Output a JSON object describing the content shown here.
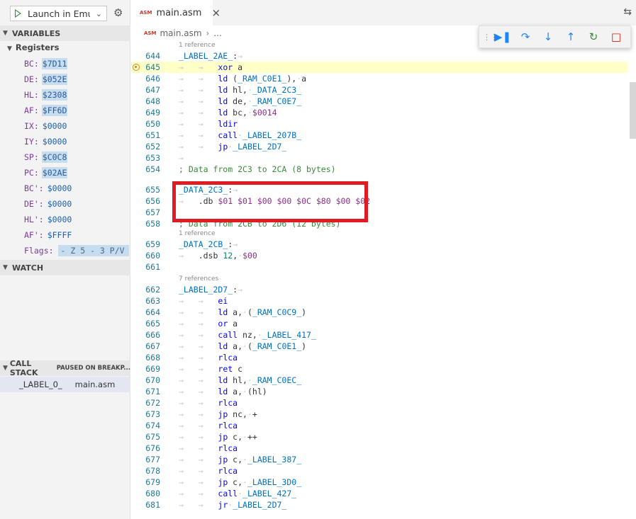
{
  "sidebar": {
    "launch_config": "Launch in Emu",
    "variables_title": "VARIABLES",
    "registers_title": "Registers",
    "registers": [
      {
        "name": "BC:",
        "value": "$7D11",
        "changed": true
      },
      {
        "name": "DE:",
        "value": "$052E",
        "changed": true
      },
      {
        "name": "HL:",
        "value": "$2308",
        "changed": true
      },
      {
        "name": "AF:",
        "value": "$FF6D",
        "changed": true
      },
      {
        "name": "IX:",
        "value": "$0000",
        "changed": false
      },
      {
        "name": "IY:",
        "value": "$0000",
        "changed": false
      },
      {
        "name": "SP:",
        "value": "$C0C8",
        "changed": true
      },
      {
        "name": "PC:",
        "value": "$02AE",
        "changed": true
      },
      {
        "name": "BC':",
        "value": "$0000",
        "changed": false
      },
      {
        "name": "DE':",
        "value": "$0000",
        "changed": false
      },
      {
        "name": "HL':",
        "value": "$0000",
        "changed": false
      },
      {
        "name": "AF':",
        "value": "$FFFF",
        "changed": false
      }
    ],
    "flags_name": "Flags:",
    "flags_value": "- Z 5 - 3 P/V",
    "watch_title": "WATCH",
    "callstack_title": "CALL STACK",
    "callstack_status": "PAUSED ON BREAKP...",
    "callstack_frame": {
      "label": "_LABEL_0_",
      "file": "main.asm"
    }
  },
  "editor": {
    "tab_title": "main.asm",
    "tab_icon": "ASM",
    "breadcrumb_file": "main.asm",
    "breadcrumb_more": "...",
    "debug_toolbar": [
      "continue-icon",
      "step-over-icon",
      "step-into-icon",
      "step-out-icon",
      "restart-icon",
      "stop-icon"
    ],
    "ref_1": "1 reference",
    "ref_7": "7 references",
    "comment_2c3": "; Data from 2C3 to 2CA (8 bytes)",
    "comment_2cb": "; Data from 2CB to 2D6 (12 bytes)",
    "db_values": "$01 $01 $00 $00 $0C $80 $00 $02"
  },
  "colors": {
    "highlight_line": "#ffffc8",
    "annotation_box": "#e01b24",
    "line_numbers": "#237893"
  }
}
